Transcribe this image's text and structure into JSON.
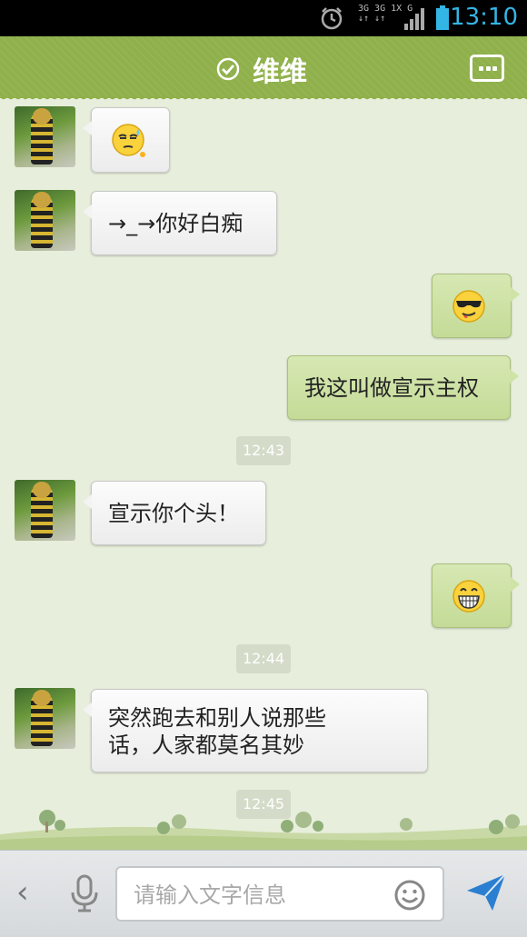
{
  "status_bar": {
    "time": "13:10",
    "network_line1": "3G 3G 1X G",
    "network_line2": "↓↑ ↓↑",
    "icons": [
      "alarm-icon",
      "signal-icon",
      "battery-icon"
    ]
  },
  "header": {
    "title": "维维",
    "icons": [
      "verified-check-icon",
      "more-options-icon"
    ]
  },
  "messages": [
    {
      "side": "left",
      "type": "emoji",
      "emoji": "sweat-face"
    },
    {
      "side": "left",
      "type": "text",
      "text": "→_→你好白痴"
    },
    {
      "side": "right",
      "type": "emoji",
      "emoji": "cool-sunglasses-face"
    },
    {
      "side": "right",
      "type": "text",
      "text": "我这叫做宣示主权"
    },
    {
      "type": "timestamp",
      "text": "12:43"
    },
    {
      "side": "left",
      "type": "text",
      "text": "宣示你个头！"
    },
    {
      "side": "right",
      "type": "emoji",
      "emoji": "grin-face"
    },
    {
      "type": "timestamp",
      "text": "12:44"
    },
    {
      "side": "left",
      "type": "text",
      "text": "突然跑去和别人说那些\n话，人家都莫名其妙",
      "line1": "突然跑去和别人说那些",
      "line2": "话，人家都莫名其妙"
    },
    {
      "type": "timestamp",
      "text": "12:45"
    }
  ],
  "input_bar": {
    "placeholder": "请输入文字信息",
    "value": "",
    "icons": [
      "back-chevron-icon",
      "microphone-icon",
      "emoji-smile-icon",
      "send-icon"
    ],
    "back_glyph": "‹"
  },
  "colors": {
    "header_green": "#8fb04a",
    "chat_bg": "#e7eedb",
    "right_bubble": "#c8de9e",
    "left_bubble": "#f3f3f3",
    "status_time": "#33b5e5",
    "send_blue": "#2a7fd0"
  }
}
